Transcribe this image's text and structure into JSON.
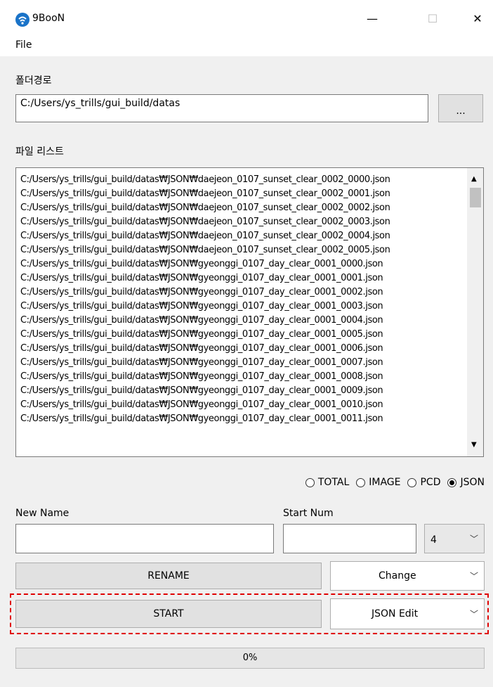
{
  "window": {
    "title": "9BooN",
    "icon": "wifi-icon",
    "controls": {
      "minimize": "—",
      "maximize": "☐",
      "close": "✕"
    }
  },
  "menu": {
    "file": "File"
  },
  "folder": {
    "label": "폴더경로",
    "path": "C:/Users/ys_trills/gui_build/datas",
    "browse_label": "..."
  },
  "file_list": {
    "label": "파일 리스트",
    "items": [
      "C:/Users/ys_trills/gui_build/datas₩JSON₩daejeon_0107_sunset_clear_0002_0000.json",
      "C:/Users/ys_trills/gui_build/datas₩JSON₩daejeon_0107_sunset_clear_0002_0001.json",
      "C:/Users/ys_trills/gui_build/datas₩JSON₩daejeon_0107_sunset_clear_0002_0002.json",
      "C:/Users/ys_trills/gui_build/datas₩JSON₩daejeon_0107_sunset_clear_0002_0003.json",
      "C:/Users/ys_trills/gui_build/datas₩JSON₩daejeon_0107_sunset_clear_0002_0004.json",
      "C:/Users/ys_trills/gui_build/datas₩JSON₩daejeon_0107_sunset_clear_0002_0005.json",
      "C:/Users/ys_trills/gui_build/datas₩JSON₩gyeonggi_0107_day_clear_0001_0000.json",
      "C:/Users/ys_trills/gui_build/datas₩JSON₩gyeonggi_0107_day_clear_0001_0001.json",
      "C:/Users/ys_trills/gui_build/datas₩JSON₩gyeonggi_0107_day_clear_0001_0002.json",
      "C:/Users/ys_trills/gui_build/datas₩JSON₩gyeonggi_0107_day_clear_0001_0003.json",
      "C:/Users/ys_trills/gui_build/datas₩JSON₩gyeonggi_0107_day_clear_0001_0004.json",
      "C:/Users/ys_trills/gui_build/datas₩JSON₩gyeonggi_0107_day_clear_0001_0005.json",
      "C:/Users/ys_trills/gui_build/datas₩JSON₩gyeonggi_0107_day_clear_0001_0006.json",
      "C:/Users/ys_trills/gui_build/datas₩JSON₩gyeonggi_0107_day_clear_0001_0007.json",
      "C:/Users/ys_trills/gui_build/datas₩JSON₩gyeonggi_0107_day_clear_0001_0008.json",
      "C:/Users/ys_trills/gui_build/datas₩JSON₩gyeonggi_0107_day_clear_0001_0009.json",
      "C:/Users/ys_trills/gui_build/datas₩JSON₩gyeonggi_0107_day_clear_0001_0010.json",
      "C:/Users/ys_trills/gui_build/datas₩JSON₩gyeonggi_0107_day_clear_0001_0011.json"
    ]
  },
  "filter": {
    "options": [
      "TOTAL",
      "IMAGE",
      "PCD",
      "JSON"
    ],
    "selected": "JSON"
  },
  "rename": {
    "new_name_label": "New Name",
    "new_name_value": "",
    "start_num_label": "Start Num",
    "start_num_value": "",
    "digits": "4",
    "rename_button": "RENAME",
    "mode": "Change"
  },
  "action": {
    "start_button": "START",
    "mode": "JSON Edit"
  },
  "progress": {
    "text": "0%",
    "value": 0
  },
  "colors": {
    "highlight": "#e00000",
    "window_bg": "#f0f0f0"
  }
}
